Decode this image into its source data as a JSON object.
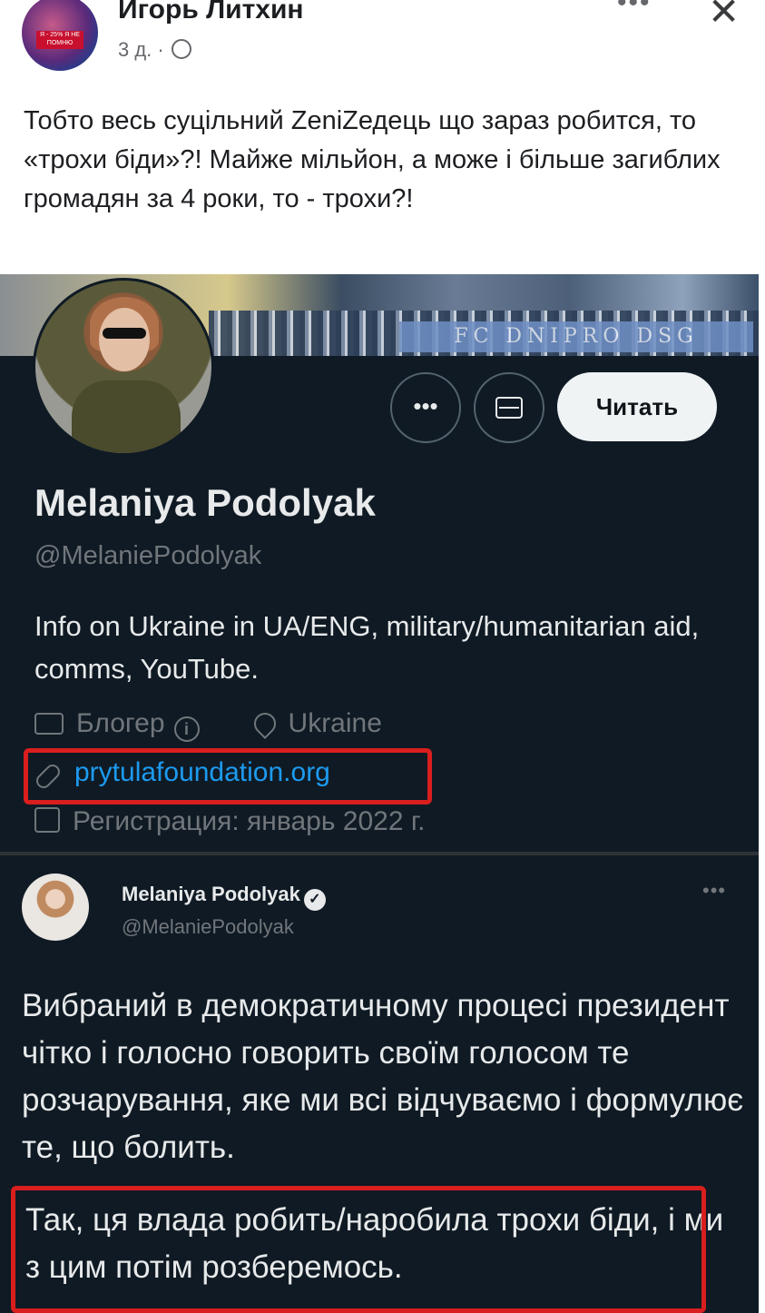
{
  "post": {
    "author": "Игорь Литхин",
    "time": "3 д. ·",
    "menu_label": "•••",
    "close_label": "✕",
    "avatar_badge": "Я - 25% Я НЕ ПОМНЮ",
    "text": "Тобто весь суцільний ZenіZедець що зараз робится, то «трохи біди»?! Майже мільйон, а може і більше загиблих громадян за 4 роки, то - трохи?!"
  },
  "profile": {
    "banner_text": "FC DNIPRO DSG",
    "display_name": "Melaniya Podolyak",
    "handle": "@MelaniePodolyak",
    "bio": "Info on Ukraine in UA/ENG, military/humanitarian aid, comms, YouTube.",
    "category": "Блогер",
    "info_glyph": "i",
    "location": "Ukraine",
    "website": "prytulafoundation.org",
    "joined": "Регистрация: январь 2022 г.",
    "more_label": "•••",
    "follow_label": "Читать"
  },
  "tweet": {
    "name": "Melaniya Podolyak",
    "verified_glyph": "✓",
    "handle": "@MelaniePodolyak",
    "more_label": "•••",
    "paragraph_1": "Вибраний в демократичному процесі президент чітко і голосно говорить своїм голосом те розчарування, яке ми всі відчуваємо і формулює те, що болить.",
    "paragraph_2": "Так, ця влада робить/наробила трохи біди, і ми з цим потім розберемось."
  },
  "colors": {
    "dark_bg": "#0f1a24",
    "link_blue": "#1d9bf0",
    "highlight_red": "#d91e1e"
  }
}
